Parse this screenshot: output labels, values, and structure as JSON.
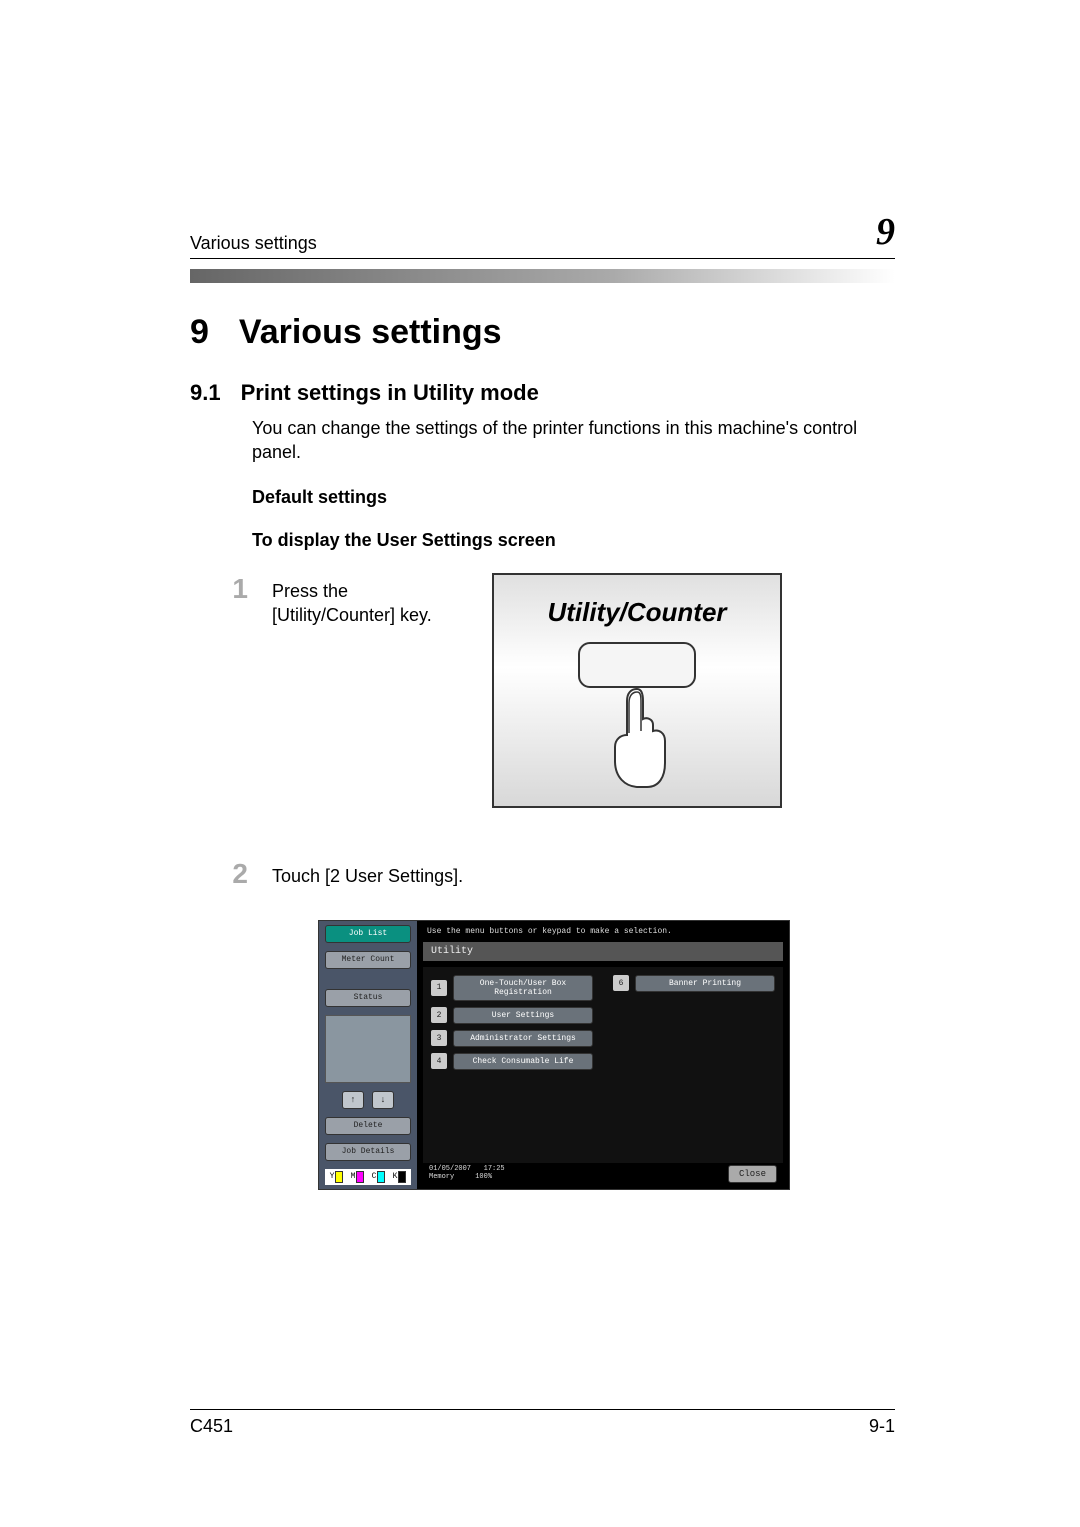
{
  "header": {
    "left": "Various settings",
    "right": "9"
  },
  "chapter": {
    "num": "9",
    "title": "Various settings"
  },
  "section": {
    "num": "9.1",
    "title": "Print settings in Utility mode"
  },
  "intro": "You can change the settings of the printer functions in this machine's control panel.",
  "subhead1": "Default settings",
  "subhead2": "To display the User Settings screen",
  "step1": {
    "num": "1",
    "text": "Press the [Utility/Counter] key."
  },
  "utility_label": "Utility/Counter",
  "step2": {
    "num": "2",
    "text": "Touch [2 User Settings]."
  },
  "screen": {
    "hint": "Use the menu buttons or keypad to make a selection.",
    "sidebar": {
      "job_list": "Job List",
      "meter_count": "Meter Count",
      "status": "Status",
      "delete": "Delete",
      "job_details": "Job Details"
    },
    "utility_title": "Utility",
    "menu": [
      {
        "n": "1",
        "label": "One-Touch/User Box Registration"
      },
      {
        "n": "2",
        "label": "User Settings"
      },
      {
        "n": "3",
        "label": "Administrator Settings"
      },
      {
        "n": "4",
        "label": "Check Consumable Life"
      }
    ],
    "menu_right": {
      "n": "6",
      "label": "Banner Printing"
    },
    "footer_date": "01/05/2007",
    "footer_time": "17:25",
    "footer_mem_label": "Memory",
    "footer_mem_val": "100%",
    "close": "Close"
  },
  "ymck": {
    "y": "Y",
    "m": "M",
    "c": "C",
    "k": "K"
  },
  "footer": {
    "left": "C451",
    "right": "9-1"
  }
}
